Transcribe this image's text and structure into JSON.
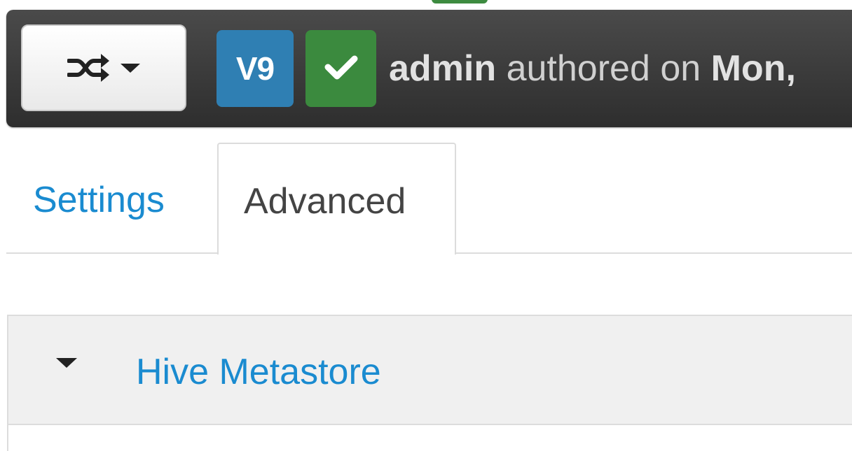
{
  "version_bar": {
    "version_label": "V9",
    "author": "admin",
    "authored_text": " authored on ",
    "date_fragment": "Mon,"
  },
  "tabs": [
    {
      "label": "Settings"
    },
    {
      "label": "Advanced"
    }
  ],
  "panel": {
    "title": "Hive Metastore"
  },
  "icons": {
    "compare": "shuffle-icon",
    "dropdown": "caret-down-icon",
    "status": "check-icon",
    "collapse": "caret-down-icon"
  },
  "colors": {
    "version_badge": "#2f7fb3",
    "status_badge": "#3b8a3e",
    "link": "#1a8bd0"
  }
}
